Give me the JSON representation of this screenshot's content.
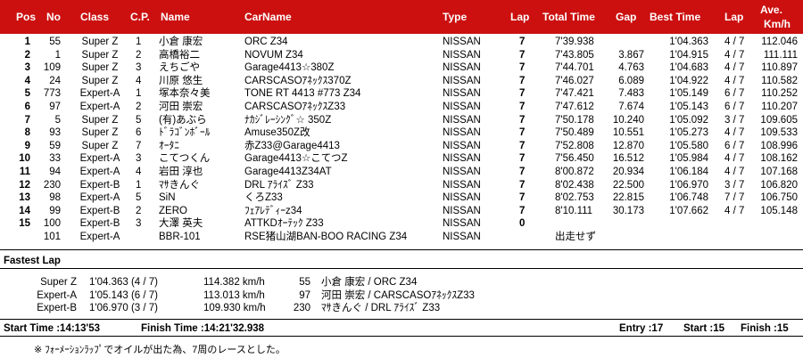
{
  "header": {
    "pos": "Pos",
    "no": "No",
    "class": "Class",
    "cp": "C.P.",
    "name": "Name",
    "carname": "CarName",
    "type": "Type",
    "lap": "Lap",
    "total_time": "Total Time",
    "gap": "Gap",
    "best_time": "Best Time",
    "best_lap": "Lap",
    "ave_line1": "Ave.",
    "ave_line2": "Km/h"
  },
  "results": [
    {
      "pos": "1",
      "no": "55",
      "class": "Super Z",
      "cp": "1",
      "name": "小倉 康宏",
      "car": "ORC Z34",
      "type": "NISSAN",
      "lap": "7",
      "total": "7'39.938",
      "gap": "",
      "best": "1'04.363",
      "best_lap": "4 / 7",
      "ave": "112.046"
    },
    {
      "pos": "2",
      "no": "1",
      "class": "Super Z",
      "cp": "2",
      "name": "高橋裕二",
      "car": "NOVUM Z34",
      "type": "NISSAN",
      "lap": "7",
      "total": "7'43.805",
      "gap": "3.867",
      "best": "1'04.915",
      "best_lap": "4 / 7",
      "ave": "111.111"
    },
    {
      "pos": "3",
      "no": "109",
      "class": "Super Z",
      "cp": "3",
      "name": "えちごや",
      "car": "Garage4413☆380Z",
      "type": "NISSAN",
      "lap": "7",
      "total": "7'44.701",
      "gap": "4.763",
      "best": "1'04.683",
      "best_lap": "4 / 7",
      "ave": "110.897"
    },
    {
      "pos": "4",
      "no": "24",
      "class": "Super Z",
      "cp": "4",
      "name": "川原 悠生",
      "car": "CARSCASOｱﾈｯｸｽ370Z",
      "type": "NISSAN",
      "lap": "7",
      "total": "7'46.027",
      "gap": "6.089",
      "best": "1'04.922",
      "best_lap": "4 / 7",
      "ave": "110.582"
    },
    {
      "pos": "5",
      "no": "773",
      "class": "Expert-A",
      "cp": "1",
      "name": "塚本奈々美",
      "car": "TONE RT 4413 #773 Z34",
      "type": "NISSAN",
      "lap": "7",
      "total": "7'47.421",
      "gap": "7.483",
      "best": "1'05.149",
      "best_lap": "6 / 7",
      "ave": "110.252"
    },
    {
      "pos": "6",
      "no": "97",
      "class": "Expert-A",
      "cp": "2",
      "name": "河田 崇宏",
      "car": "CARSCASOｱﾈｯｸｽZ33",
      "type": "NISSAN",
      "lap": "7",
      "total": "7'47.612",
      "gap": "7.674",
      "best": "1'05.143",
      "best_lap": "6 / 7",
      "ave": "110.207"
    },
    {
      "pos": "7",
      "no": "5",
      "class": "Super Z",
      "cp": "5",
      "name": "(有)あぶら",
      "car": "ﾅｶｼﾞﾚｰｼﾝｸﾞ☆ 350Z",
      "type": "NISSAN",
      "lap": "7",
      "total": "7'50.178",
      "gap": "10.240",
      "best": "1'05.092",
      "best_lap": "3 / 7",
      "ave": "109.605"
    },
    {
      "pos": "8",
      "no": "93",
      "class": "Super Z",
      "cp": "6",
      "name": "ﾄﾞﾗｺﾞﾝﾎﾞｰﾙ",
      "car": "Amuse350Z改",
      "type": "NISSAN",
      "lap": "7",
      "total": "7'50.489",
      "gap": "10.551",
      "best": "1'05.273",
      "best_lap": "4 / 7",
      "ave": "109.533"
    },
    {
      "pos": "9",
      "no": "59",
      "class": "Super Z",
      "cp": "7",
      "name": "ｵｰﾀﾆ",
      "car": "赤Z33@Garage4413",
      "type": "NISSAN",
      "lap": "7",
      "total": "7'52.808",
      "gap": "12.870",
      "best": "1'05.580",
      "best_lap": "6 / 7",
      "ave": "108.996"
    },
    {
      "pos": "10",
      "no": "33",
      "class": "Expert-A",
      "cp": "3",
      "name": "こてつくん",
      "car": "Garage4413☆こてつZ",
      "type": "NISSAN",
      "lap": "7",
      "total": "7'56.450",
      "gap": "16.512",
      "best": "1'05.984",
      "best_lap": "4 / 7",
      "ave": "108.162"
    },
    {
      "pos": "11",
      "no": "94",
      "class": "Expert-A",
      "cp": "4",
      "name": "岩田 淳也",
      "car": "Garage4413Z34AT",
      "type": "NISSAN",
      "lap": "7",
      "total": "8'00.872",
      "gap": "20.934",
      "best": "1'06.184",
      "best_lap": "4 / 7",
      "ave": "107.168"
    },
    {
      "pos": "12",
      "no": "230",
      "class": "Expert-B",
      "cp": "1",
      "name": "ﾏｻきんぐ",
      "car": "DRL ｱﾗｲｽﾞ Z33",
      "type": "NISSAN",
      "lap": "7",
      "total": "8'02.438",
      "gap": "22.500",
      "best": "1'06.970",
      "best_lap": "3 / 7",
      "ave": "106.820"
    },
    {
      "pos": "13",
      "no": "98",
      "class": "Expert-A",
      "cp": "5",
      "name": "SiN",
      "car": "くろZ33",
      "type": "NISSAN",
      "lap": "7",
      "total": "8'02.753",
      "gap": "22.815",
      "best": "1'06.748",
      "best_lap": "7 / 7",
      "ave": "106.750"
    },
    {
      "pos": "14",
      "no": "99",
      "class": "Expert-B",
      "cp": "2",
      "name": "ZERO",
      "car": "ﾌｪｱﾚﾃﾞｨｰz34",
      "type": "NISSAN",
      "lap": "7",
      "total": "8'10.111",
      "gap": "30.173",
      "best": "1'07.662",
      "best_lap": "4 / 7",
      "ave": "105.148"
    },
    {
      "pos": "15",
      "no": "100",
      "class": "Expert-B",
      "cp": "3",
      "name": "大澤 英夫",
      "car": "ATTKDｵｰﾃｯｸ Z33",
      "type": "NISSAN",
      "lap": "0",
      "total": "",
      "gap": "",
      "best": "",
      "best_lap": "",
      "ave": ""
    },
    {
      "pos": "",
      "no": "101",
      "class": "Expert-A",
      "cp": "",
      "name": "BBR-101",
      "car": "RSE猪山湖BAN-BOO RACING Z34",
      "type": "NISSAN",
      "lap": "",
      "total": "出走せず",
      "gap": "",
      "best": "",
      "best_lap": "",
      "ave": ""
    }
  ],
  "fastest_lap": {
    "title": "Fastest Lap",
    "rows": [
      {
        "class": "Super Z",
        "time": "1'04.363 (4 / 7)",
        "speed": "114.382 km/h",
        "no": "55",
        "driver": "小倉 康宏 / ORC Z34"
      },
      {
        "class": "Expert-A",
        "time": "1'05.143 (6 / 7)",
        "speed": "113.013 km/h",
        "no": "97",
        "driver": "河田 崇宏 / CARSCASOｱﾈｯｸｽZ33"
      },
      {
        "class": "Expert-B",
        "time": "1'06.970 (3 / 7)",
        "speed": "109.930 km/h",
        "no": "230",
        "driver": "ﾏｻきんぐ / DRL ｱﾗｲｽﾞ Z33"
      }
    ]
  },
  "footer": {
    "start_time": "Start Time :14:13'53",
    "finish_time": "Finish Time :14:21'32.938",
    "entry": "Entry :17",
    "start": "Start :15",
    "finish": "Finish :15"
  },
  "note": "※ ﾌｫｰﾒｰｼｮﾝﾗｯﾌﾟでオイルが出た為、7周のレースとした。"
}
